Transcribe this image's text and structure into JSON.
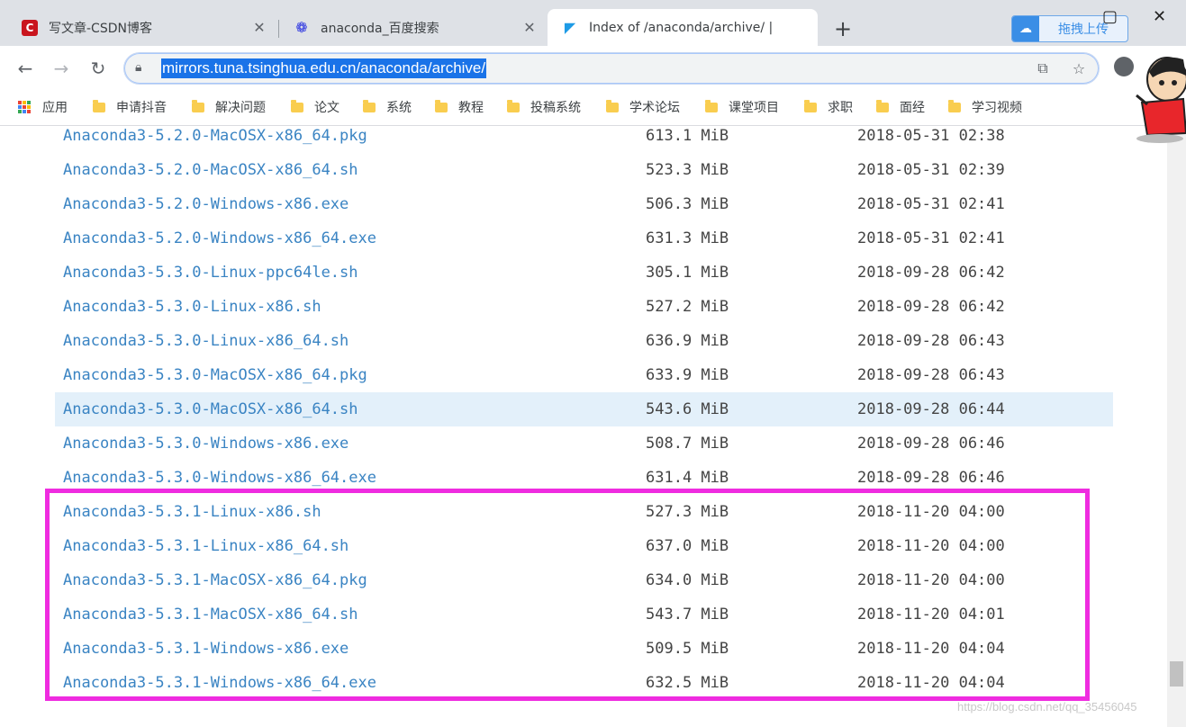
{
  "tabs": [
    {
      "title": "写文章-CSDN博客",
      "favicon": "csdn-icon",
      "favicon_color": "#c9151e",
      "active": false
    },
    {
      "title": "anaconda_百度搜索",
      "favicon": "baidu-paw-icon",
      "favicon_color": "#2932e1",
      "active": false
    },
    {
      "title": "Index of /anaconda/archive/ |",
      "favicon": "tuna-dolphin-icon",
      "favicon_color": "#1e9be6",
      "active": true
    }
  ],
  "upload_button": {
    "label": "拖拽上传"
  },
  "address_bar": {
    "url": "mirrors.tuna.tsinghua.edu.cn/anaconda/archive/"
  },
  "bookmarks": [
    "应用",
    "申请抖音",
    "解决问题",
    "论文",
    "系统",
    "教程",
    "投稿系统",
    "学术论坛",
    "课堂项目",
    "求职",
    "面经",
    "学习视频"
  ],
  "files": [
    {
      "name": "Anaconda3-5.2.0-MacOSX-x86_64.pkg",
      "size": "613.1 MiB",
      "date": "2018-05-31 02:38"
    },
    {
      "name": "Anaconda3-5.2.0-MacOSX-x86_64.sh",
      "size": "523.3 MiB",
      "date": "2018-05-31 02:39"
    },
    {
      "name": "Anaconda3-5.2.0-Windows-x86.exe",
      "size": "506.3 MiB",
      "date": "2018-05-31 02:41"
    },
    {
      "name": "Anaconda3-5.2.0-Windows-x86_64.exe",
      "size": "631.3 MiB",
      "date": "2018-05-31 02:41"
    },
    {
      "name": "Anaconda3-5.3.0-Linux-ppc64le.sh",
      "size": "305.1 MiB",
      "date": "2018-09-28 06:42"
    },
    {
      "name": "Anaconda3-5.3.0-Linux-x86.sh",
      "size": "527.2 MiB",
      "date": "2018-09-28 06:42"
    },
    {
      "name": "Anaconda3-5.3.0-Linux-x86_64.sh",
      "size": "636.9 MiB",
      "date": "2018-09-28 06:43"
    },
    {
      "name": "Anaconda3-5.3.0-MacOSX-x86_64.pkg",
      "size": "633.9 MiB",
      "date": "2018-09-28 06:43"
    },
    {
      "name": "Anaconda3-5.3.0-MacOSX-x86_64.sh",
      "size": "543.6 MiB",
      "date": "2018-09-28 06:44",
      "hovered": true
    },
    {
      "name": "Anaconda3-5.3.0-Windows-x86.exe",
      "size": "508.7 MiB",
      "date": "2018-09-28 06:46"
    },
    {
      "name": "Anaconda3-5.3.0-Windows-x86_64.exe",
      "size": "631.4 MiB",
      "date": "2018-09-28 06:46"
    },
    {
      "name": "Anaconda3-5.3.1-Linux-x86.sh",
      "size": "527.3 MiB",
      "date": "2018-11-20 04:00"
    },
    {
      "name": "Anaconda3-5.3.1-Linux-x86_64.sh",
      "size": "637.0 MiB",
      "date": "2018-11-20 04:00"
    },
    {
      "name": "Anaconda3-5.3.1-MacOSX-x86_64.pkg",
      "size": "634.0 MiB",
      "date": "2018-11-20 04:00"
    },
    {
      "name": "Anaconda3-5.3.1-MacOSX-x86_64.sh",
      "size": "543.7 MiB",
      "date": "2018-11-20 04:01"
    },
    {
      "name": "Anaconda3-5.3.1-Windows-x86.exe",
      "size": "509.5 MiB",
      "date": "2018-11-20 04:04"
    },
    {
      "name": "Anaconda3-5.3.1-Windows-x86_64.exe",
      "size": "632.5 MiB",
      "date": "2018-11-20 04:04"
    }
  ],
  "watermark": "https://blog.csdn.net/qq_35456045",
  "colors": {
    "link": "#3a84c3",
    "highlight_box": "#ef2ce0",
    "row_hover": "#e3f0fa",
    "url_selection": "#1a73e8"
  }
}
